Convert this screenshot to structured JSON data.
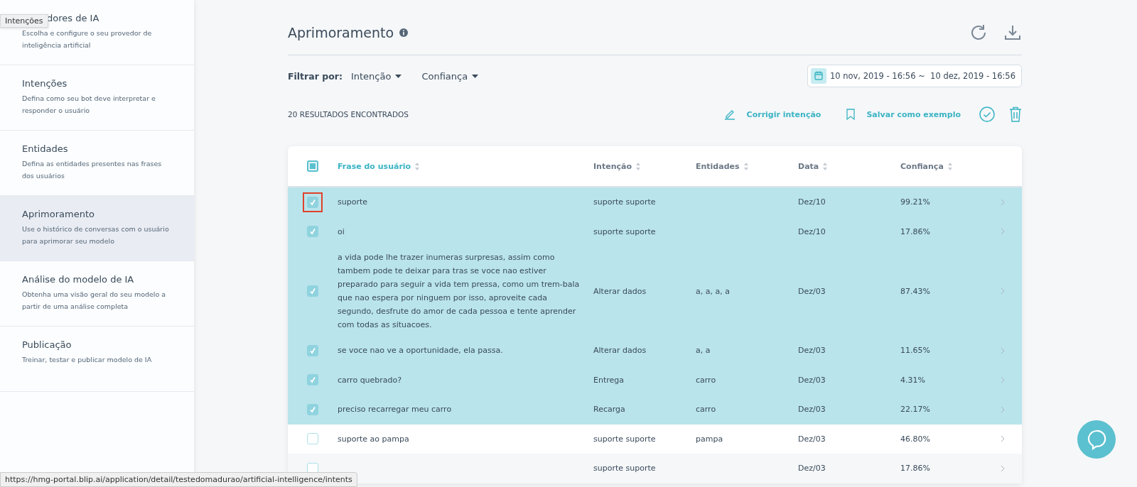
{
  "tooltip": "Intenções",
  "sidebar": {
    "items": [
      {
        "title": "dores de IA",
        "description": "Escolha e configure o seu provedor de inteligência artificial",
        "selected": false
      },
      {
        "title": "Intenções",
        "description": "Defina como seu bot deve interpretar e responder o usuário",
        "selected": false
      },
      {
        "title": "Entidades",
        "description": "Defina as entidades presentes nas frases dos usuários",
        "selected": false
      },
      {
        "title": "Aprimoramento",
        "description": "Use o histórico de conversas com o usuário para aprimorar seu modelo",
        "selected": true
      },
      {
        "title": "Análise do modelo de IA",
        "description": "Obtenha uma visão geral do seu modelo a partir de uma análise completa",
        "selected": false
      },
      {
        "title": "Publicação",
        "description": "Treinar, testar e publicar modelo de IA",
        "selected": false
      }
    ]
  },
  "page": {
    "title": "Aprimoramento"
  },
  "filters": {
    "label": "Filtrar por:",
    "dropdowns": [
      "Intenção",
      "Confiança"
    ],
    "date_range": "10 nov, 2019 - 16:56 ~  10 dez, 2019 - 16:56"
  },
  "results": {
    "count": "20 RESULTADOS ENCONTRADOS",
    "actions": [
      "Corrigir intenção",
      "Salvar como exemplo"
    ]
  },
  "table": {
    "header_checkbox": {
      "checked": true
    },
    "columns": [
      "Frase do usuário",
      "Intenção",
      "Entidades",
      "Data",
      "Confiança"
    ],
    "rows": [
      {
        "phrase": "suporte",
        "intent": "suporte suporte",
        "entities": "",
        "date": "Dez/10",
        "confidence": "99.21%",
        "checked": true,
        "focused": true
      },
      {
        "phrase": "oi",
        "intent": "suporte suporte",
        "entities": "",
        "date": "Dez/10",
        "confidence": "17.86%",
        "checked": true,
        "focused": false
      },
      {
        "phrase": "a vida pode lhe trazer inumeras surpresas, assim como tambem pode te deixar para tras se voce nao estiver preparado para seguir a vida tem pressa, como um trem-bala que nao espera por ninguem por isso, aproveite cada segundo, desfrute do amor de cada pessoa e tente aprender com todas as situacoes.",
        "intent": "Alterar dados",
        "entities": "a, a, a, a",
        "date": "Dez/03",
        "confidence": "87.43%",
        "checked": true,
        "focused": false
      },
      {
        "phrase": "se voce nao ve a oportunidade, ela passa.",
        "intent": "Alterar dados",
        "entities": "a, a",
        "date": "Dez/03",
        "confidence": "11.65%",
        "checked": true,
        "focused": false
      },
      {
        "phrase": "carro quebrado?",
        "intent": "Entrega",
        "entities": "carro",
        "date": "Dez/03",
        "confidence": "4.31%",
        "checked": true,
        "focused": false
      },
      {
        "phrase": "preciso recarregar meu carro",
        "intent": "Recarga",
        "entities": "carro",
        "date": "Dez/03",
        "confidence": "22.17%",
        "checked": true,
        "focused": false
      },
      {
        "phrase": "suporte ao pampa",
        "intent": "suporte suporte",
        "entities": "pampa",
        "date": "Dez/03",
        "confidence": "46.80%",
        "checked": false,
        "focused": false
      },
      {
        "intent": "suporte suporte",
        "entities": "",
        "date": "Dez/03",
        "confidence": "17.86%",
        "checked": false,
        "focused": false
      }
    ]
  },
  "status_bar": "https://hmg-portal.blip.ai/application/detail/testedomadurao/artificial-intelligence/intents"
}
